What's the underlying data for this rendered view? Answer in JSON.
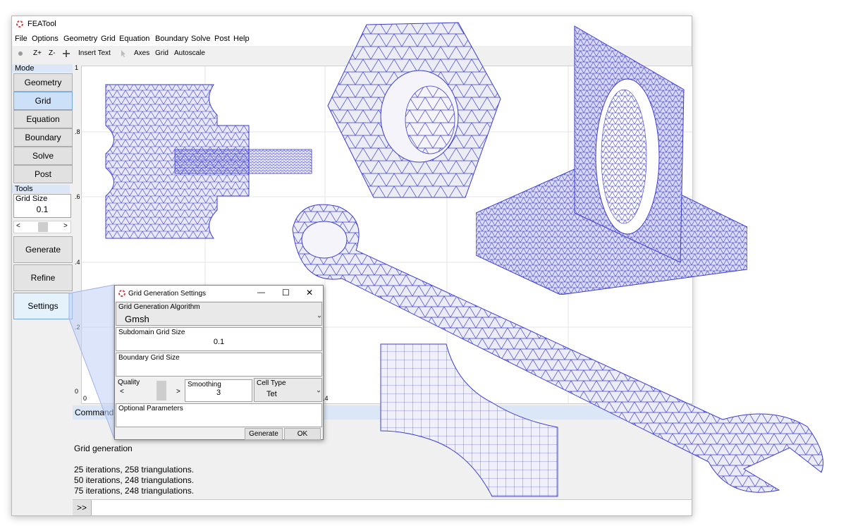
{
  "window": {
    "title": "FEATool"
  },
  "menu": [
    "File",
    "Options",
    "Geometry",
    "Grid",
    "Equation",
    "Boundary",
    "Solve",
    "Post",
    "Help"
  ],
  "toolbar": {
    "zoom_in": "Z+",
    "zoom_out": "Z-",
    "insert_text": "Insert Text",
    "axes": "Axes",
    "grid": "Grid",
    "autoscale": "Autoscale"
  },
  "mode": {
    "header": "Mode",
    "buttons": [
      "Geometry",
      "Grid",
      "Equation",
      "Boundary",
      "Solve",
      "Post"
    ],
    "active": "Grid"
  },
  "tools": {
    "header": "Tools",
    "grid_size_label": "Grid Size",
    "grid_size_value": "0.1",
    "scroll_left": "<",
    "scroll_right": ">",
    "generate": "Generate",
    "refine": "Refine",
    "settings": "Settings"
  },
  "plot": {
    "y_ticks": [
      "1",
      ".8",
      ".6",
      ".4",
      ".2",
      "0"
    ],
    "x_ticks": [
      "0",
      ".4"
    ]
  },
  "command": {
    "header": "Command",
    "log": [
      "Grid generation",
      "",
      "25 iterations, 258 triangulations.",
      "50 iterations, 248 triangulations.",
      "75 iterations, 248 triangulations."
    ],
    "prompt": ">>"
  },
  "dialog": {
    "title": "Grid Generation Settings",
    "minimize": "—",
    "maximize": "☐",
    "close": "✕",
    "algorithm_label": "Grid Generation Algorithm",
    "algorithm_value": "Gmsh",
    "subdomain_label": "Subdomain Grid Size",
    "subdomain_value": "0.1",
    "boundary_label": "Boundary Grid Size",
    "boundary_value": "",
    "quality_label": "Quality",
    "quality_left": "<",
    "quality_right": ">",
    "smoothing_label": "Smoothing",
    "smoothing_value": "3",
    "celltype_label": "Cell Type",
    "celltype_value": "Tet",
    "optional_label": "Optional Parameters",
    "generate": "Generate",
    "ok": "OK"
  },
  "colors": {
    "mesh": "#3b3bd6",
    "mesh_fill": "#e8e8f6",
    "accent": "#cce0f7"
  }
}
